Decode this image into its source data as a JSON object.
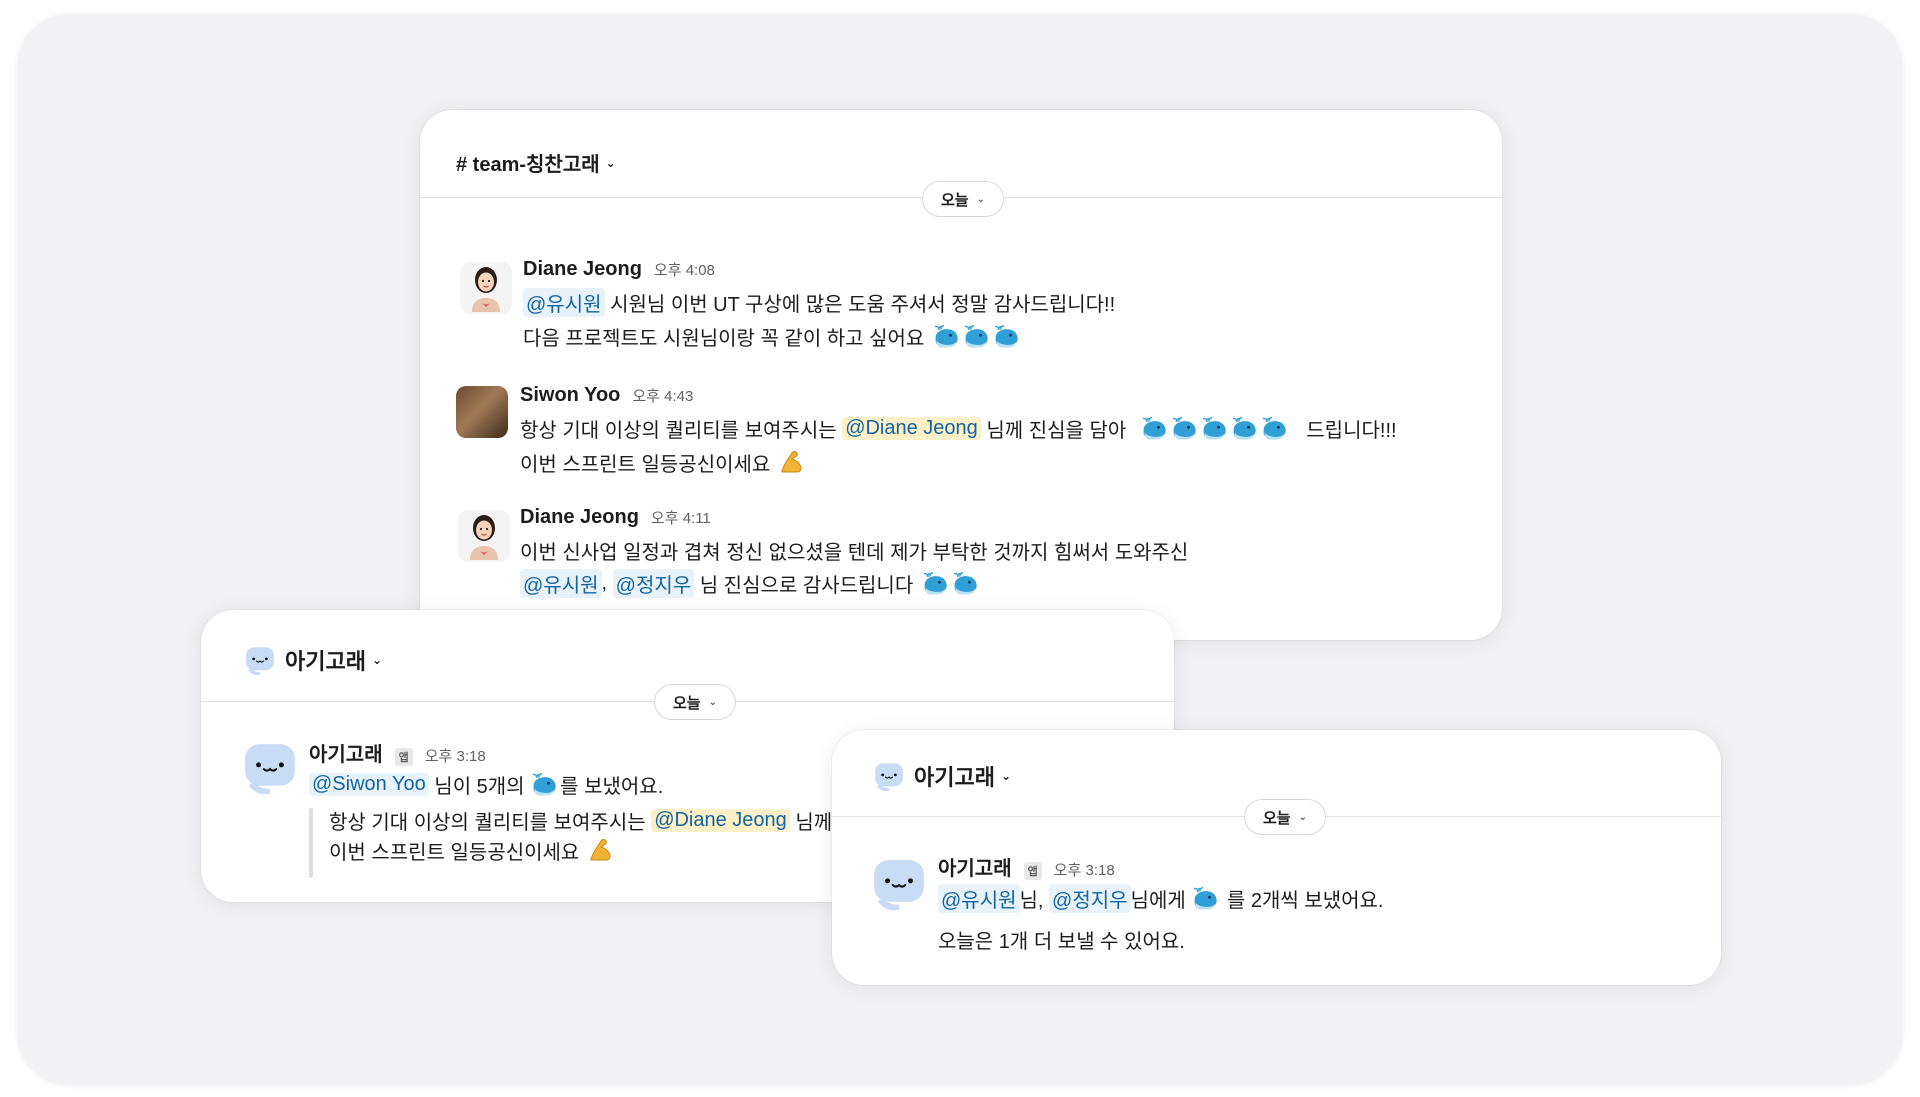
{
  "win1": {
    "channel": "# team-칭찬고래",
    "date_label": "오늘",
    "messages": [
      {
        "sender": "Diane Jeong",
        "time": "오후 4:08",
        "line1_mention": "@유시원",
        "line1_text": " 시원님 이번 UT 구상에 많은 도움 주셔서 정말 감사드립니다!!",
        "line2_text": "다음 프로젝트도 시원님이랑 꼭 같이 하고 싶어요"
      },
      {
        "sender": "Siwon Yoo",
        "time": "오후 4:43",
        "line1_text_a": "항상 기대 이상의 퀄리티를 보여주시는 ",
        "line1_mention": "@Diane Jeong",
        "line1_text_b": " 님께 진심을 담아",
        "line1_text_c": "드립니다!!!",
        "line2_text": "이번 스프린트 일등공신이세요"
      },
      {
        "sender": "Diane Jeong",
        "time": "오후 4:11",
        "line1_text": "이번 신사업 일정과 겹쳐 정신 없으셨을 텐데 제가 부탁한 것까지 힘써서 도와주신",
        "line2_mention_a": "@유시원",
        "line2_sep": ", ",
        "line2_mention_b": "@정지우",
        "line2_text": " 님 진심으로 감사드립니다"
      }
    ]
  },
  "win2": {
    "channel": "아기고래",
    "date_label": "오늘",
    "message": {
      "sender": "아기고래",
      "badge": "앱",
      "time": "오후 3:18",
      "line1_mention": "@Siwon Yoo",
      "line1_text_a": " 님이 5개의 ",
      "line1_text_b": "를 보냈어요.",
      "quote_line1_a": "항상 기대 이상의 퀄리티를 보여주시는 ",
      "quote_line1_mention": "@Diane Jeong",
      "quote_line1_b": " 님께 진",
      "quote_line2": "이번 스프린트 일등공신이세요"
    }
  },
  "win3": {
    "channel": "아기고래",
    "date_label": "오늘",
    "message": {
      "sender": "아기고래",
      "badge": "앱",
      "time": "오후 3:18",
      "line1_mention_a": "@유시원",
      "line1_sep": "님, ",
      "line1_mention_b": "@정지우",
      "line1_text_a": "님에게 ",
      "line1_text_b": " 를 2개씩 보냈어요.",
      "line2_text": "오늘은 1개 더 보낼 수 있어요."
    }
  },
  "colors": {
    "mention_text": "#1264a3",
    "mention_bg": "#e8f2fa",
    "mention_self_bg": "#fdf0c6",
    "whale": "#2f9fd6",
    "canvas": "#f2f2f5"
  },
  "icons": [
    "whale-emoji",
    "flexed-biceps-emoji",
    "baby-whale-bot-icon",
    "chevron-down-icon"
  ]
}
